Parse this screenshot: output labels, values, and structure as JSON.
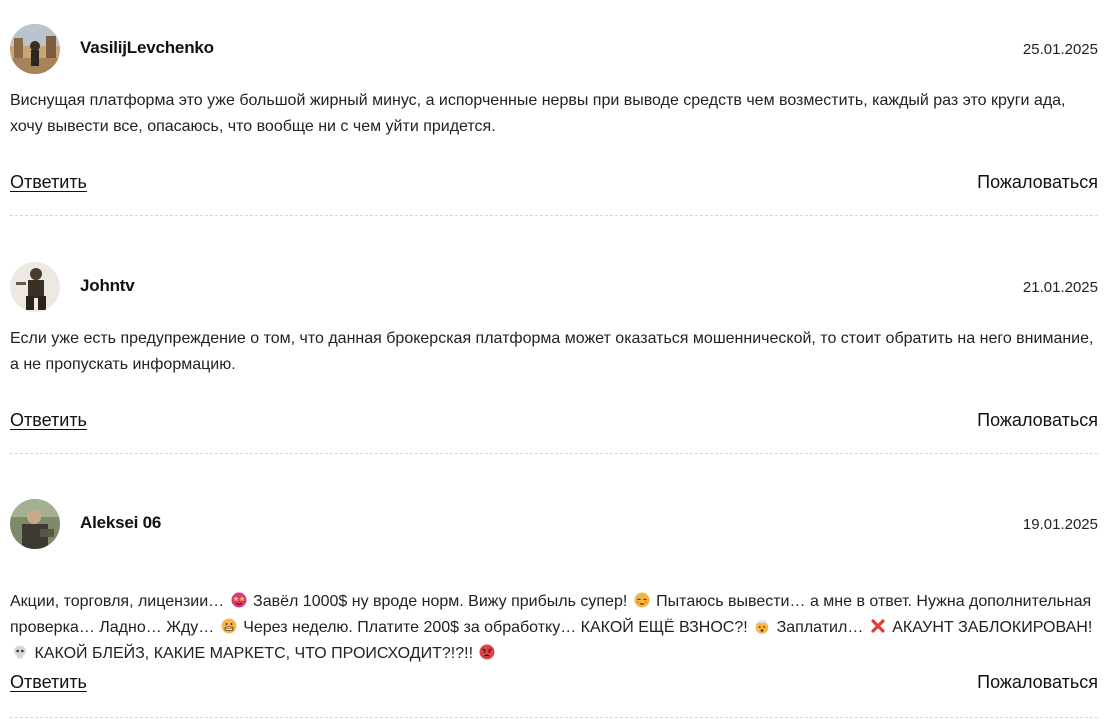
{
  "comments": [
    {
      "author": "VasilijLevchenko",
      "date": "25.01.2025",
      "text": "Виснущая платформа это уже большой жирный минус, а испорченные нервы при выводе средств чем возместить, каждый раз это круги ада, хочу вывести все, опасаюсь, что вообще ни с чем уйти придется.",
      "reply_label": "Ответить",
      "report_label": "Пожаловаться"
    },
    {
      "author": "Johntv",
      "date": "21.01.2025",
      "text": "Если уже есть предупреждение о том, что данная брокерская платформа может оказаться мошеннической, то стоит обратить на него внимание, а не пропускать информацию.",
      "reply_label": "Ответить",
      "report_label": "Пожаловаться"
    },
    {
      "author": "Aleksei 06",
      "date": "19.01.2025",
      "text_parts": [
        "Акции, торговля, лицензии… ",
        " Завёл 1000$ ну вроде норм. Вижу прибыль супер! ",
        " Пытаюсь вывести… а мне в ответ. Нужна дополнительная проверка… Ладно… Жду… ",
        " Через неделю. Платите 200$ за обработку… КАКОЙ ЕЩЁ ВЗНОС?! ",
        " Заплатил… ",
        " АКАУНТ ЗАБЛОКИРОВАН! ",
        " КАКОЙ БЛЕЙЗ, КАКИЕ МАРКЕТС, ЧТО ПРОИСХОДИТ?!?!! ",
        ""
      ],
      "emoji_icons": [
        "star-struck-face-icon",
        "relieved-face-icon",
        "grimacing-face-icon",
        "exploding-head-icon",
        "cross-mark-icon",
        "skull-icon",
        "angry-face-icon"
      ],
      "reply_label": "Ответить",
      "report_label": "Пожаловаться"
    }
  ]
}
